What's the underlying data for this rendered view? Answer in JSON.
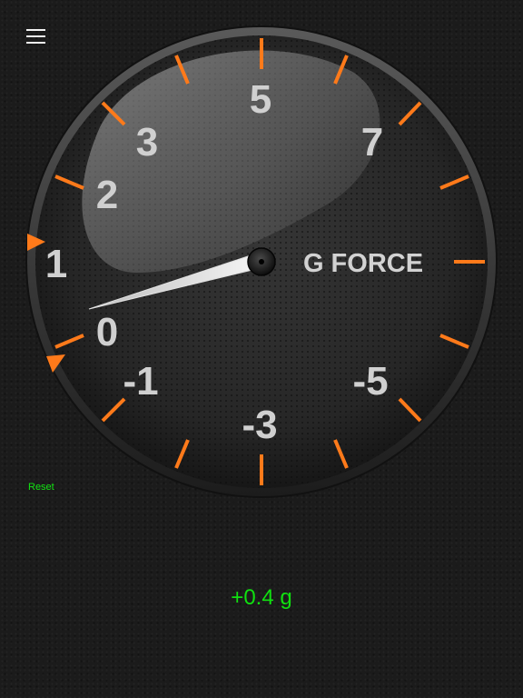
{
  "menu": {
    "icon": "hamburger-menu-icon"
  },
  "gauge": {
    "label": "G FORCE",
    "scale_labels": [
      "5",
      "3",
      "7",
      "2",
      "1",
      "0",
      "-1",
      "-5",
      "-3"
    ],
    "needle_value_g": 0.4,
    "max_marker_icon": "triangle-marker-icon",
    "min_marker_icon": "triangle-marker-icon",
    "colors": {
      "ticks": "#ff7a1a",
      "labels": "#d0d0d0",
      "face": "#2a2a2a",
      "readout": "#10e010"
    }
  },
  "controls": {
    "reset_label": "Reset"
  },
  "readout": {
    "value_text": "+0.4 g"
  }
}
